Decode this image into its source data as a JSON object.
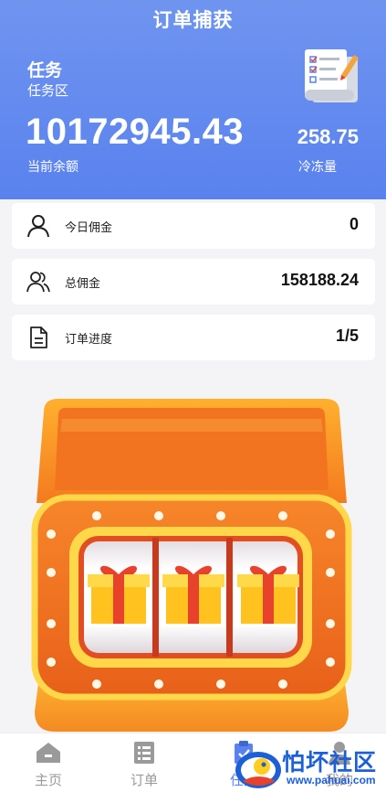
{
  "header": {
    "title": "订单捕获",
    "task_title": "任务",
    "task_subtitle": "任务区",
    "balance": "10172945.43",
    "balance_label": "当前余额",
    "frozen": "258.75",
    "frozen_label": "冷冻量"
  },
  "cards": [
    {
      "label": "今日佣金",
      "value": "0",
      "icon": "user-icon"
    },
    {
      "label": "总佣金",
      "value": "158188.24",
      "icon": "users-icon"
    },
    {
      "label": "订单进度",
      "value": "1/5",
      "icon": "document-icon"
    }
  ],
  "tabbar": {
    "items": [
      {
        "label": "主页",
        "icon": "home-icon"
      },
      {
        "label": "订单",
        "icon": "list-icon"
      },
      {
        "label": "任务",
        "icon": "clipboard-icon"
      },
      {
        "label": "我的",
        "icon": "profile-icon"
      }
    ],
    "active_index": 2
  },
  "watermark": {
    "title": "怕坏社区",
    "url": "www.pahuai.com"
  },
  "colors": {
    "header_blue": "#5a82ee",
    "slot_orange": "#f47a1f",
    "slot_yellow": "#ffd84a",
    "gift_red": "#e8412c",
    "watermark_blue": "#1d5fd6"
  }
}
